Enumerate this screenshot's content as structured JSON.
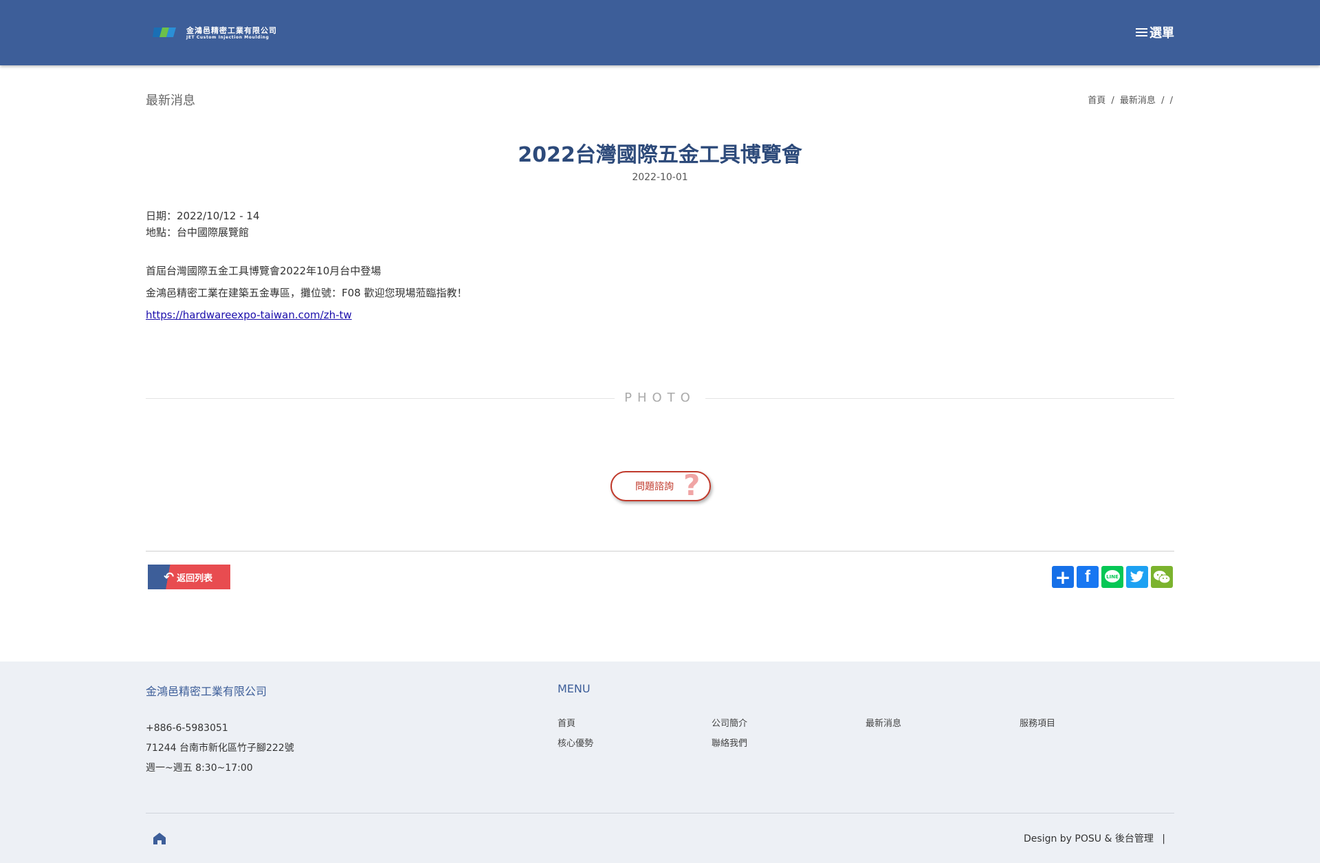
{
  "header": {
    "logo_cn": "金鴻邑精密工業有限公司",
    "logo_en": "JET Custom Injection Moulding",
    "menu_label": "選單"
  },
  "page": {
    "section_title": "最新消息",
    "breadcrumb": [
      "首頁",
      "/",
      "最新消息",
      "/",
      "/"
    ]
  },
  "article": {
    "title": "2022台灣國際五金工具博覽會",
    "date": "2022-10-01",
    "line_date": "日期：2022/10/12 - 14",
    "line_place": "地點：台中國際展覽館",
    "line_intro": "首屆台灣國際五金工具博覽會2022年10月台中登場",
    "line_booth": "金鴻邑精密工業在建築五金專區，攤位號：F08 歡迎您現場蒞臨指教！",
    "link": "https://hardwareexpo-taiwan.com/zh-tw"
  },
  "photo_label": "PHOTO",
  "faq_button": "問題諮詢",
  "back_button": "返回列表",
  "share_icons": [
    "add-share-icon",
    "facebook-icon",
    "line-icon",
    "twitter-icon",
    "wechat-icon"
  ],
  "colors": {
    "header_bg": "#3d5e99",
    "accent_red": "#e84c50",
    "footer_bg": "#edf0f5",
    "share_add": "#1670e8",
    "facebook": "#1877f2",
    "line": "#06c755",
    "twitter": "#1da1f2",
    "wechat": "#7bb32e"
  },
  "footer": {
    "company": "金鴻邑精密工業有限公司",
    "phone": "+886-6-5983051",
    "address": "71244 台南市新化區竹子腳222號",
    "hours": "週一~週五 8:30~17:00",
    "menu_title": "MENU",
    "menu_items": [
      "首頁",
      "公司簡介",
      "最新消息",
      "服務項目",
      "核心優勢",
      "聯絡我們"
    ],
    "credit": "Design by POSU & 後台管理"
  }
}
